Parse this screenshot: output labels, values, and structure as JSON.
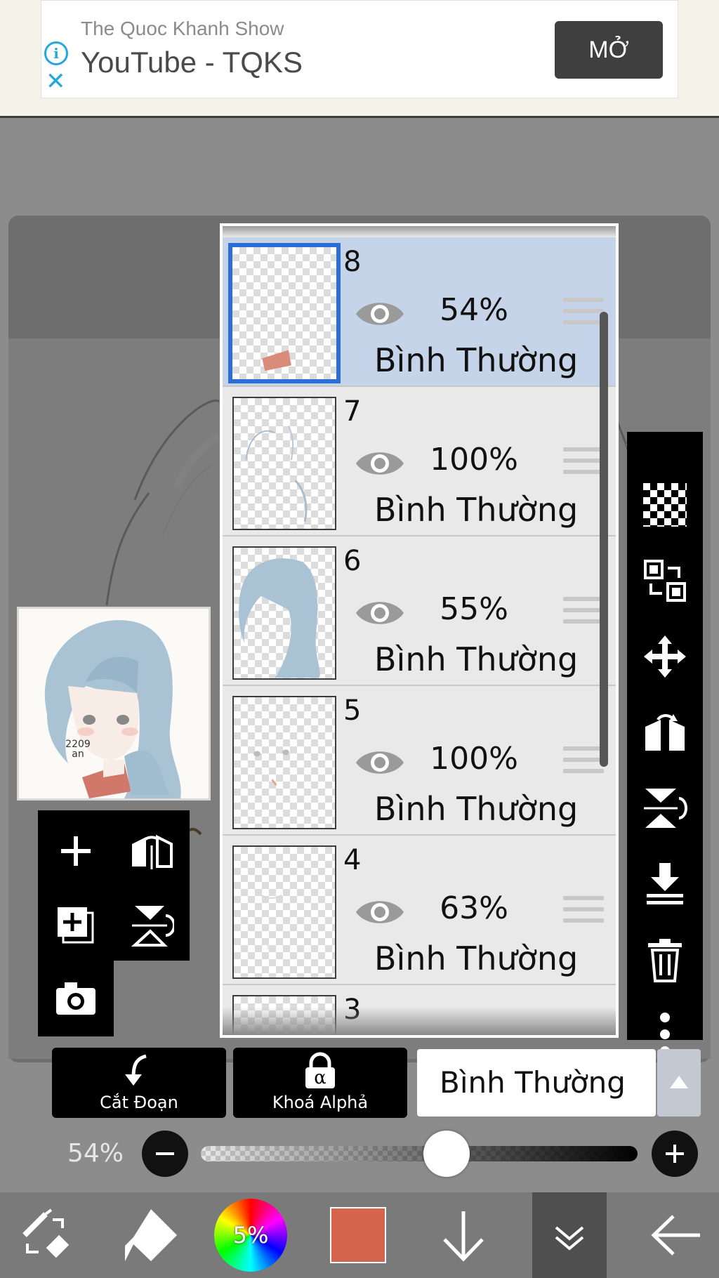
{
  "ad": {
    "subtitle": "The Quoc Khanh Show",
    "title": "YouTube - TQKS",
    "open_label": "MỞ",
    "info_glyph": "i",
    "close_glyph": "✕"
  },
  "layers": [
    {
      "num": "8",
      "opacity": "54%",
      "blend": "Bình Thường",
      "selected": true
    },
    {
      "num": "7",
      "opacity": "100%",
      "blend": "Bình Thường",
      "selected": false
    },
    {
      "num": "6",
      "opacity": "55%",
      "blend": "Bình Thường",
      "selected": false
    },
    {
      "num": "5",
      "opacity": "100%",
      "blend": "Bình Thường",
      "selected": false
    },
    {
      "num": "4",
      "opacity": "63%",
      "blend": "Bình Thường",
      "selected": false
    },
    {
      "num": "3",
      "opacity": "",
      "blend": "",
      "selected": false
    }
  ],
  "preview": {
    "signature": "2209 an"
  },
  "left_tools": [
    "add-layer-icon",
    "flip-horizontal-icon",
    "duplicate-layer-icon",
    "flip-vertical-icon",
    "camera-icon"
  ],
  "right_tools": [
    "transparent-bg-icon",
    "swap-layer-icon",
    "move-icon",
    "flip-horizontal-icon",
    "flip-vertical-icon",
    "merge-down-icon",
    "trash-icon",
    "more-vertical-icon"
  ],
  "clipping": {
    "label": "Cắt Đoạn"
  },
  "alpha_lock": {
    "label": "Khoá Alphả",
    "glyph": "α"
  },
  "blend_mode": {
    "value": "Bình Thường"
  },
  "opacity": {
    "label": "54%",
    "value": 0.54
  },
  "bottom_bar": {
    "color_wheel_label": "5%",
    "current_color": "#d4644c",
    "items": [
      "brush-eraser-swap-icon",
      "fill-shape-icon",
      "color-wheel",
      "color-swatch",
      "arrow-down-icon",
      "chevron-double-down-icon",
      "arrow-left-icon"
    ]
  },
  "colors": {
    "accent_blue": "#2a6fd8",
    "selected_row": "#c6d4ea",
    "ad_accent": "#22a7e0"
  }
}
